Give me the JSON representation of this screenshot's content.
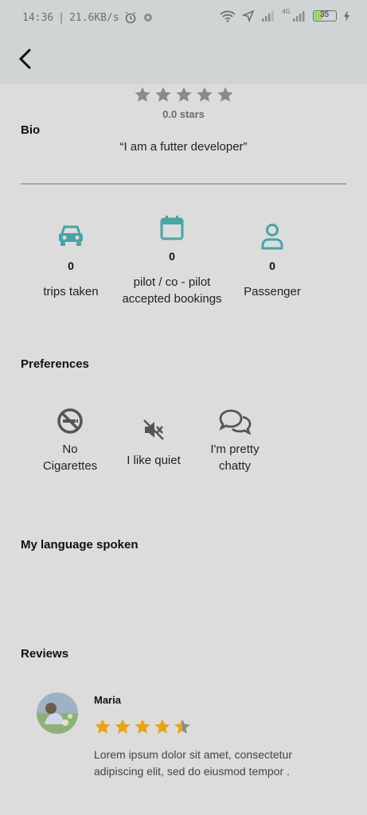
{
  "status": {
    "time": "14:36",
    "speed": "21.6KB/s",
    "battery": "35",
    "network": "4G"
  },
  "rating": {
    "caption": "0.0 stars",
    "value": 0,
    "max": 5
  },
  "bio": {
    "title": "Bio",
    "quote": "“I am a futter developer”"
  },
  "stats": [
    {
      "icon": "car-icon",
      "value": "0",
      "label": "trips taken"
    },
    {
      "icon": "calendar-icon",
      "value": "0",
      "label_line1": "pilot / co - pilot",
      "label_line2": "accepted bookings"
    },
    {
      "icon": "person-icon",
      "value": "0",
      "label": "Passenger"
    }
  ],
  "preferences": {
    "title": "Preferences",
    "items": [
      {
        "icon": "no-smoking-icon",
        "line1": "No",
        "line2": "Cigarettes"
      },
      {
        "icon": "muted-speaker-icon",
        "line1": "I like quiet"
      },
      {
        "icon": "chat-bubbles-icon",
        "line1": "I'm pretty",
        "line2": "chatty"
      }
    ]
  },
  "languages": {
    "title": "My language spoken"
  },
  "reviews": {
    "title": "Reviews",
    "items": [
      {
        "name": "Maria",
        "rating": 4.5,
        "text": "Lorem ipsum dolor sit amet, consectetur adipiscing elit, sed do eiusmod tempor ."
      }
    ]
  },
  "colors": {
    "accent": "#4aa3a6",
    "star_gold": "#e8a417",
    "star_gray": "#8a8a8a"
  }
}
